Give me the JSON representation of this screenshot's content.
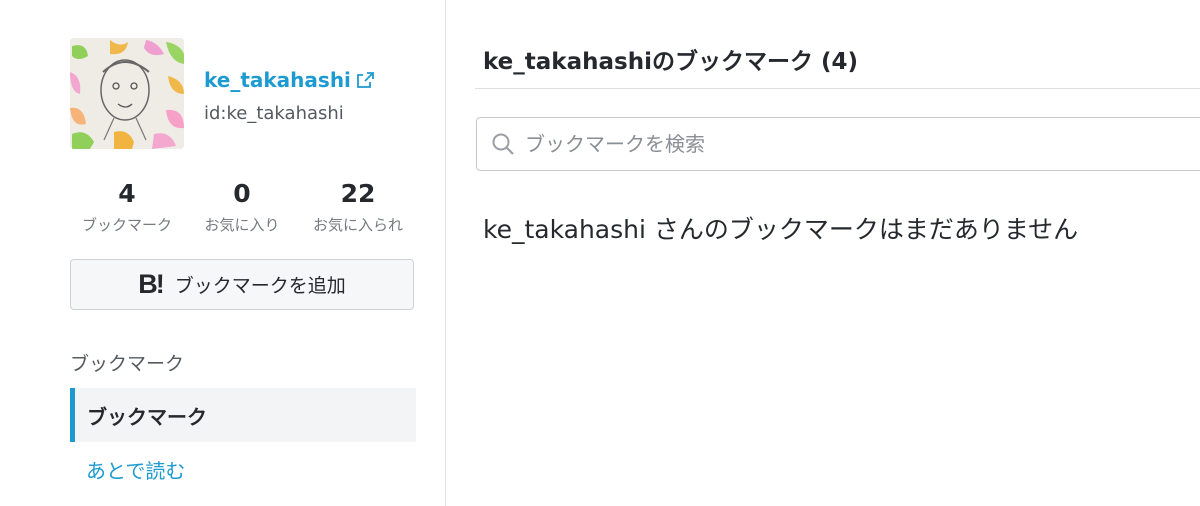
{
  "profile": {
    "name": "ke_takahashi",
    "id": "id:ke_takahashi"
  },
  "stats": [
    {
      "value": "4",
      "label": "ブックマーク"
    },
    {
      "value": "0",
      "label": "お気に入り"
    },
    {
      "value": "22",
      "label": "お気に入られ"
    }
  ],
  "add_button": {
    "icon_text": "B!",
    "label": "ブックマークを追加"
  },
  "sidebar": {
    "section_title": "ブックマーク",
    "items": [
      {
        "label": "ブックマーク",
        "active": true
      },
      {
        "label": "あとで読む",
        "active": false
      }
    ]
  },
  "main": {
    "title": "ke_takahashiのブックマーク (4)",
    "search_placeholder": "ブックマークを検索",
    "empty_message": "ke_takahashi さんのブックマークはまだありません"
  },
  "colors": {
    "accent": "#1d9bd1",
    "text": "#25292e",
    "muted": "#767b80"
  },
  "icons": [
    "external-link-icon",
    "search-icon",
    "hatena-bookmark-icon"
  ]
}
